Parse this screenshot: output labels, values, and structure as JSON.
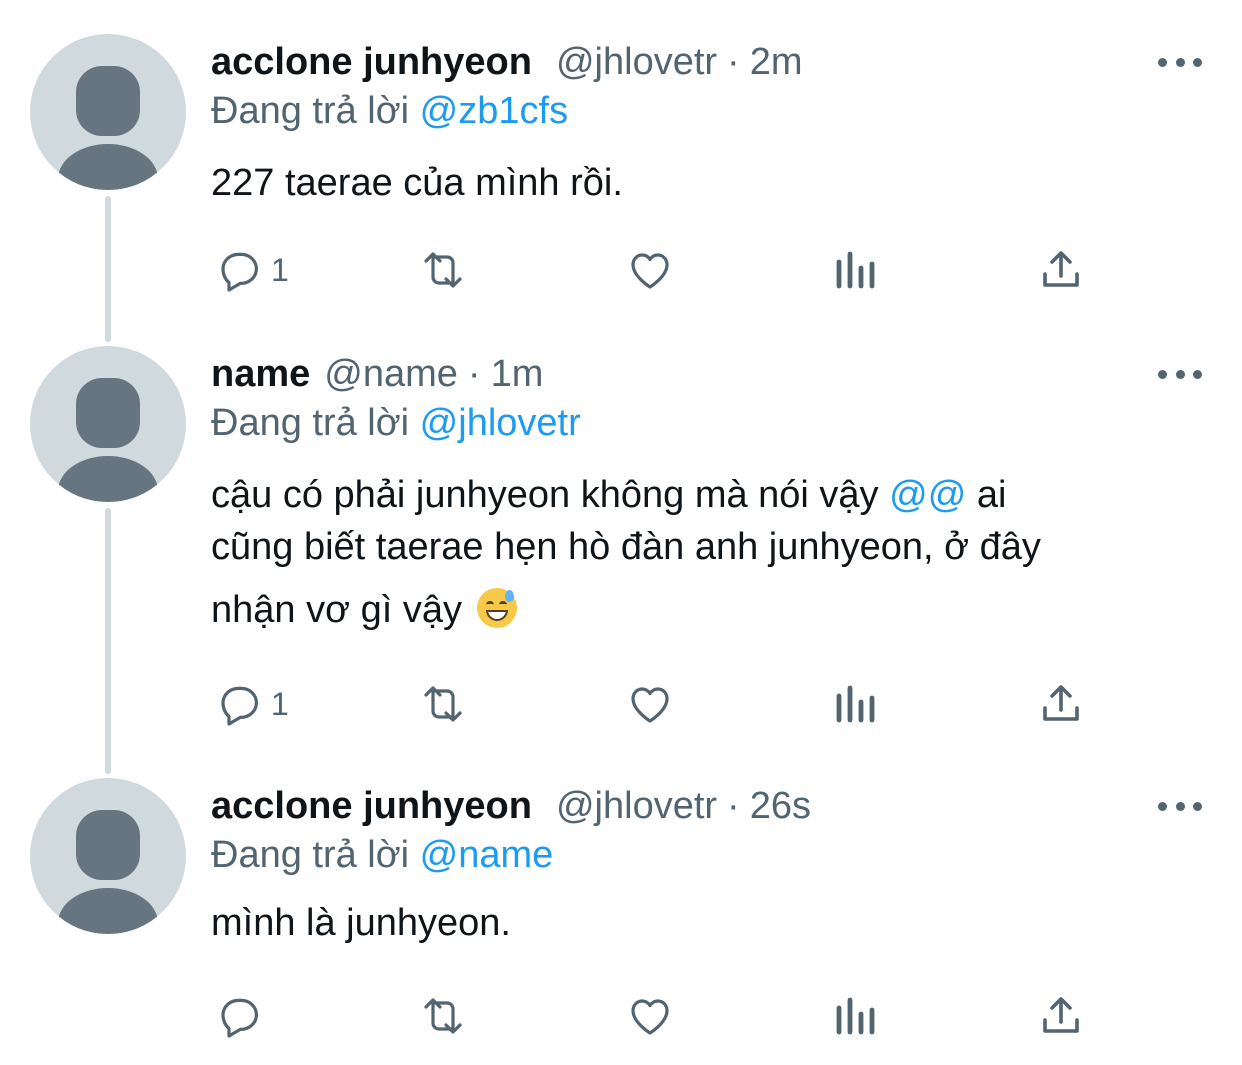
{
  "colors": {
    "accent": "#1d9bf0",
    "secondary_text": "#536471",
    "primary_text": "#0f1419",
    "thread_line": "#cfd9de"
  },
  "tweets": [
    {
      "display_name": "acclone junhyeon",
      "handle": "@jhlovetr",
      "separator": "·",
      "time": "2m",
      "reply_prefix": "Đang trả lời",
      "reply_to": "@zb1cfs",
      "text_lines": [
        "227 taerae của mình rồi."
      ],
      "reply_count": "1",
      "icons": [
        "reply-icon",
        "retweet-icon",
        "like-icon",
        "views-icon",
        "share-icon",
        "more-icon"
      ]
    },
    {
      "display_name": "name",
      "handle": "@name",
      "separator": "·",
      "time": "1m",
      "reply_prefix": "Đang trả lời",
      "reply_to": "@jhlovetr",
      "text_line1_a": "cậu có phải junhyeon không mà nói vậy",
      "text_line1_mention": "@@",
      "text_line1_b": "ai",
      "text_line2": "cũng biết taerae hẹn hò đàn anh junhyeon, ở đây",
      "text_line3": "nhận vơ gì vậy",
      "emoji": "grinning-face-with-sweat",
      "reply_count": "1",
      "icons": [
        "reply-icon",
        "retweet-icon",
        "like-icon",
        "views-icon",
        "share-icon",
        "more-icon"
      ]
    },
    {
      "display_name": "acclone junhyeon",
      "handle": "@jhlovetr",
      "separator": "·",
      "time": "26s",
      "reply_prefix": "Đang trả lời",
      "reply_to": "@name",
      "text_lines": [
        "mình là junhyeon."
      ],
      "reply_count": "",
      "icons": [
        "reply-icon",
        "retweet-icon",
        "like-icon",
        "views-icon",
        "share-icon",
        "more-icon"
      ]
    }
  ]
}
